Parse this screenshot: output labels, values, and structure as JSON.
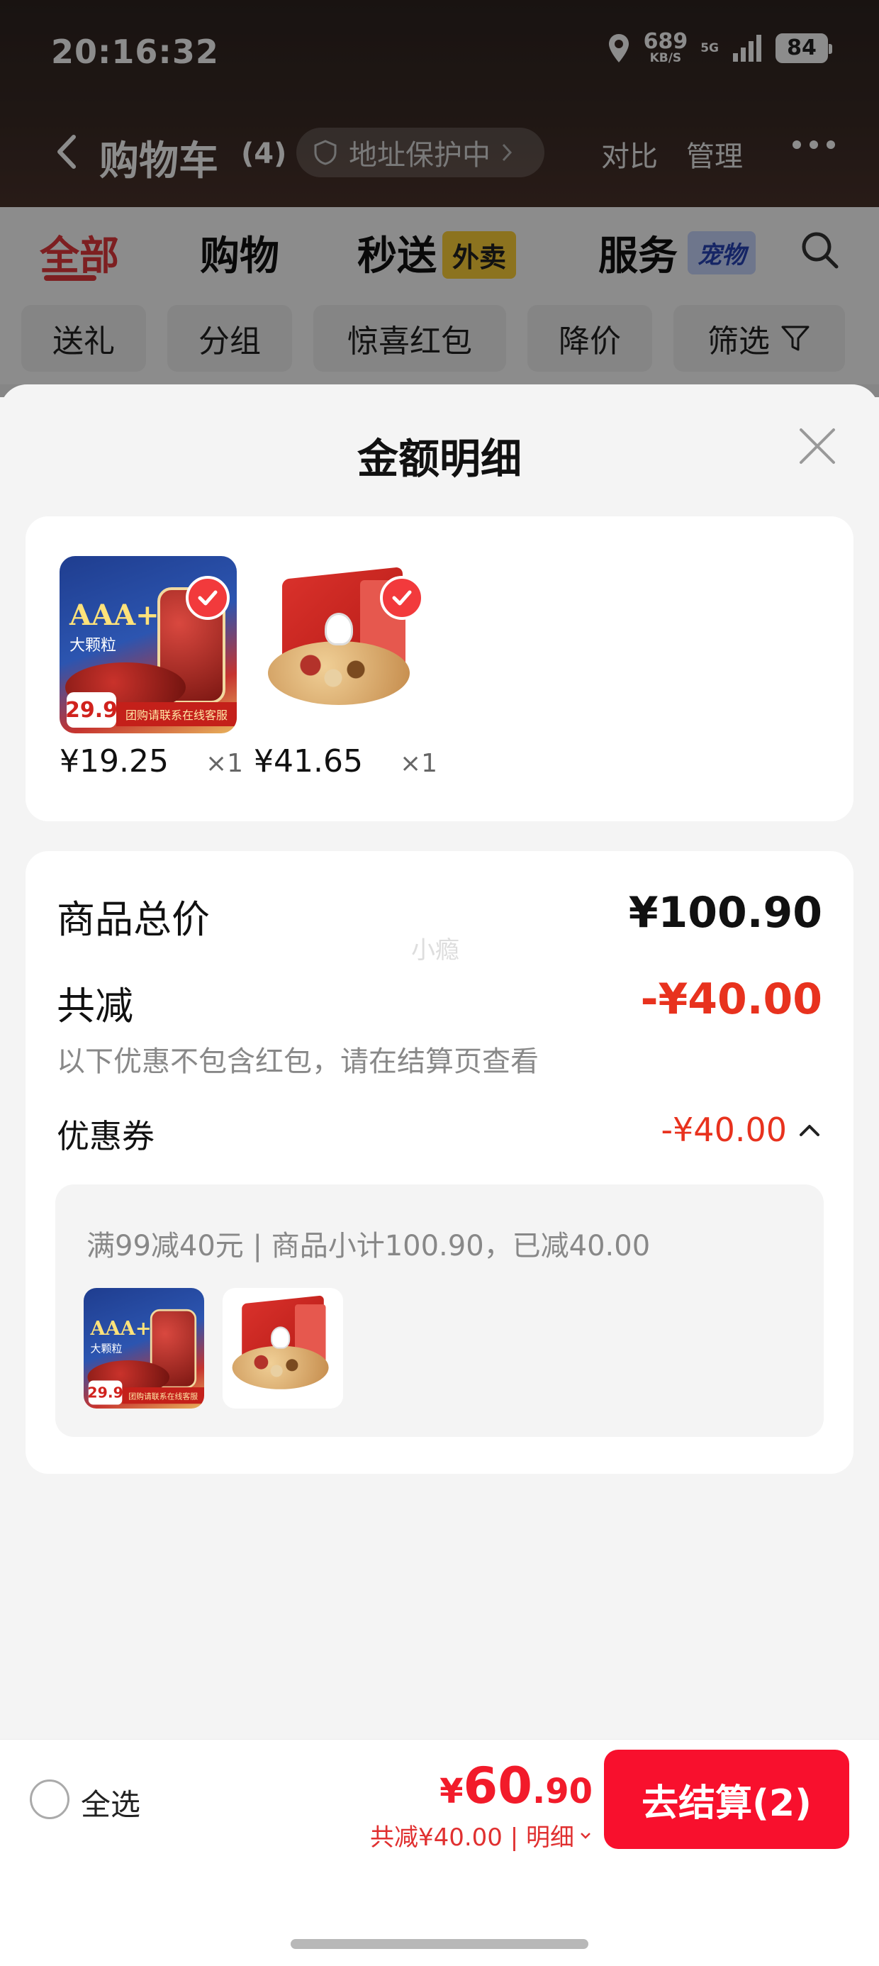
{
  "status_bar": {
    "time": "20:16:32",
    "speed_value": "689",
    "speed_unit": "KB/S",
    "network": "5G",
    "battery": "84"
  },
  "nav": {
    "title": "购物车",
    "count": "(4)",
    "address_pill": "地址保护中",
    "compare": "对比",
    "manage": "管理"
  },
  "tabs": [
    {
      "label": "全部",
      "active": true
    },
    {
      "label": "购物"
    },
    {
      "label": "秒送",
      "tag": "外卖"
    },
    {
      "label": "服务",
      "tag": "宠物"
    }
  ],
  "chips": [
    "送礼",
    "分组",
    "惊喜红包",
    "降价",
    "筛选"
  ],
  "sheet": {
    "title": "金额明细",
    "products": [
      {
        "price": "¥19.25",
        "qty": "×1",
        "art": {
          "brand": "AAA+",
          "sub": "大颗粒",
          "tag": "29.9",
          "banner": "团购请联系在线客服"
        }
      },
      {
        "price": "¥41.65",
        "qty": "×1"
      }
    ],
    "summary": {
      "total_label": "商品总价",
      "total_value": "¥100.90",
      "watermark": "小瘾",
      "discount_label": "共减",
      "discount_value": "-¥40.00",
      "note": "以下优惠不包含红包，请在结算页查看",
      "coupon_label": "优惠券",
      "coupon_value": "-¥40.00",
      "coupon_desc": "满99减40元 | 商品小计100.90，已减40.00"
    }
  },
  "bottom_bar": {
    "select_all": "全选",
    "currency": "¥",
    "total_int": "60",
    "total_dec": ".90",
    "saved": "共减¥40.00 | 明细",
    "checkout": "去结算(2)"
  },
  "colors": {
    "accent_red": "#f8102d",
    "discount_red": "#e8321e",
    "tab_active": "#e4393c"
  }
}
